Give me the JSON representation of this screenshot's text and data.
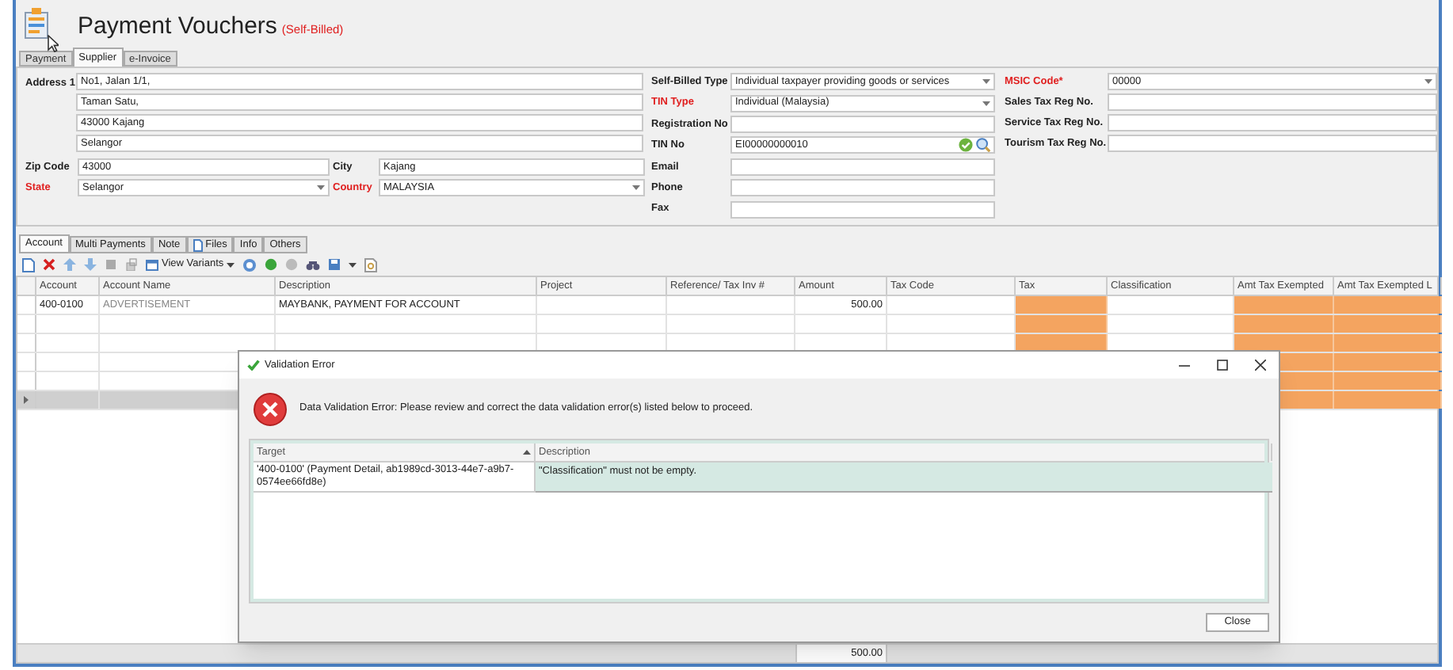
{
  "window": {
    "title": "Payment Vouchers",
    "subtitle": "(Self-Billed)"
  },
  "tabs": [
    {
      "label": "Payment",
      "selected": false
    },
    {
      "label": "Supplier",
      "selected": true
    },
    {
      "label": "e-Invoice",
      "selected": false
    }
  ],
  "address": {
    "label": "Address 1",
    "lines": [
      "No1, Jalan 1/1,",
      "Taman Satu,",
      "43000 Kajang",
      "Selangor"
    ]
  },
  "location_fields": [
    {
      "label": "Zip Code",
      "value": "43000",
      "kind": "text",
      "required": false
    },
    {
      "label": "City",
      "value": "Kajang",
      "kind": "text",
      "required": false
    },
    {
      "label": "State",
      "value": "Selangor",
      "kind": "dropdown",
      "required": true
    },
    {
      "label": "Country",
      "value": "MALAYSIA",
      "kind": "dropdown",
      "required": true
    }
  ],
  "tax_fields": [
    {
      "label": "Self-Billed Type",
      "value": "Individual taxpayer providing goods or services",
      "kind": "dropdown",
      "required": false
    },
    {
      "label": "TIN Type",
      "value": "Individual (Malaysia)",
      "kind": "dropdown",
      "required": true
    },
    {
      "label": "Registration No",
      "kind": "text",
      "required": false
    },
    {
      "label": "TIN No",
      "value": "EI00000000010",
      "kind": "tin",
      "required": false
    },
    {
      "label": "Email",
      "kind": "text",
      "required": false
    },
    {
      "label": "Phone",
      "kind": "text",
      "required": false
    },
    {
      "label": "Fax",
      "kind": "text",
      "required": false
    }
  ],
  "registration_fields": [
    {
      "label": "MSIC Code*",
      "value": "00000",
      "kind": "dropdown",
      "required": true
    },
    {
      "label": "Sales Tax Reg No.",
      "kind": "text",
      "required": false
    },
    {
      "label": "Service Tax Reg No.",
      "kind": "text",
      "required": false
    },
    {
      "label": "Tourism Tax Reg No.",
      "kind": "text",
      "required": false
    }
  ],
  "detail_tabs": [
    {
      "label": "Account",
      "selected": true,
      "kind": "plain"
    },
    {
      "label": "Multi Payments",
      "selected": false,
      "kind": "plain"
    },
    {
      "label": "Note",
      "selected": false,
      "kind": "plain"
    },
    {
      "label": "Files",
      "selected": false,
      "kind": "icon"
    },
    {
      "label": "Info",
      "selected": false,
      "kind": "plain"
    },
    {
      "label": "Others",
      "selected": false,
      "kind": "plain"
    }
  ],
  "toolbar": {
    "view_variants": "View Variants"
  },
  "table": {
    "columns": [
      {
        "label": "Account",
        "highlighted": false
      },
      {
        "label": "Account Name",
        "highlighted": false
      },
      {
        "label": "Description",
        "highlighted": false
      },
      {
        "label": "Project",
        "highlighted": false
      },
      {
        "label": "Reference/ Tax Inv #",
        "highlighted": false
      },
      {
        "label": "Amount",
        "highlighted": false
      },
      {
        "label": "Tax Code",
        "highlighted": false
      },
      {
        "label": "Tax",
        "highlighted": true
      },
      {
        "label": "Classification",
        "highlighted": false
      },
      {
        "label": "Amt Tax Exempted",
        "highlighted": true
      },
      {
        "label": "Amt Tax Exempted L",
        "highlighted": true
      }
    ],
    "rows": [
      {
        "selected": false,
        "account": "400-0100",
        "account_name": "ADVERTISEMENT",
        "description": "MAYBANK, PAYMENT FOR ACCOUNT",
        "amount": "500.00"
      },
      {
        "selected": false
      },
      {
        "selected": false
      },
      {
        "selected": false
      },
      {
        "selected": false
      },
      {
        "selected": true
      }
    ],
    "footer": {
      "amount": "500.00"
    }
  },
  "dialog": {
    "title": "Validation Error",
    "message": "Data Validation Error: Please review and correct the data validation error(s) listed below to proceed.",
    "columns": [
      {
        "label": "Target",
        "sorted": true
      },
      {
        "label": "Description",
        "sorted": false
      }
    ],
    "rows": [
      {
        "target": "'400-0100' (Payment Detail, ab1989cd-3013-44e7-a9b7-0574ee66fd8e)",
        "description": "\"Classification\" must not be empty.",
        "selected": true
      }
    ],
    "buttons": [
      "Close"
    ]
  }
}
